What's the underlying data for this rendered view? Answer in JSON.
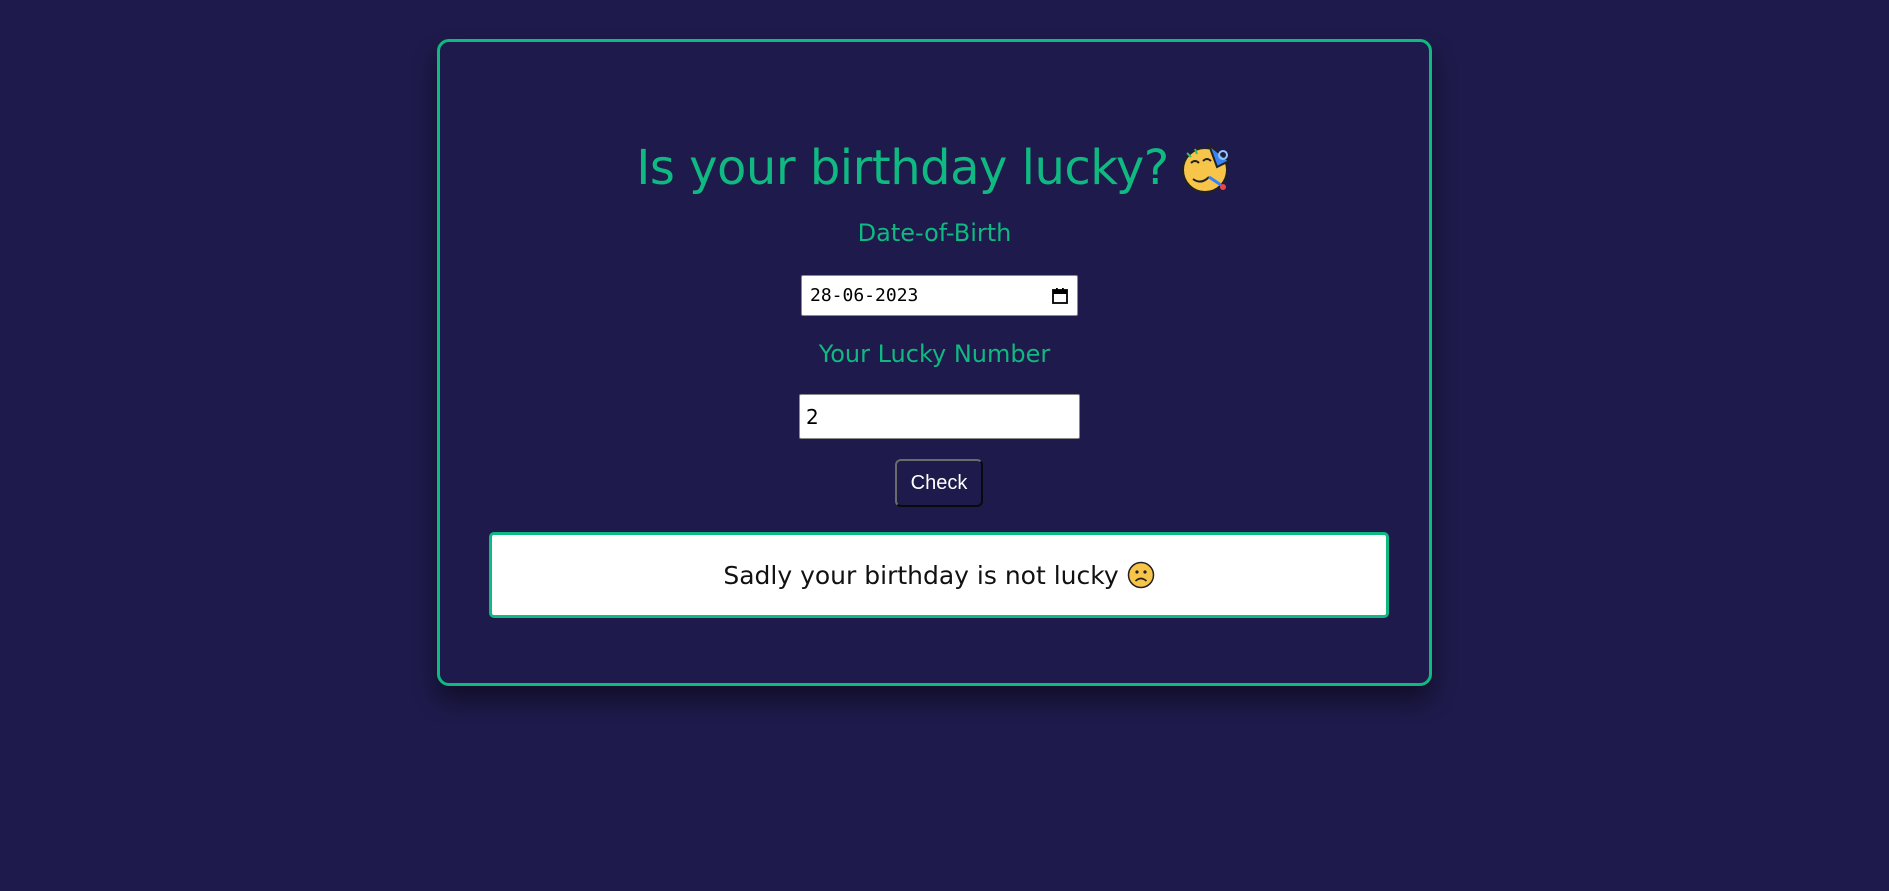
{
  "heading": {
    "title": "Is your birthday lucky?",
    "title_icon": "partying-face-icon"
  },
  "form": {
    "dob_label": "Date-of-Birth",
    "dob_value": "28-06-2023",
    "dob_icon": "calendar-icon",
    "lucky_label": "Your Lucky Number",
    "lucky_value": "2",
    "check_label": "Check"
  },
  "result": {
    "message": "Sadly your birthday is not lucky",
    "icon": "slightly-frowning-face-icon"
  },
  "colors": {
    "background": "#1e1a4b",
    "accent": "#10b981",
    "input_bg": "#ffffff"
  }
}
